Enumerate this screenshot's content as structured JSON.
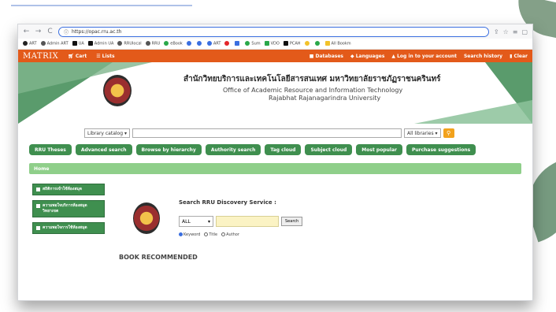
{
  "browser": {
    "nav_back": "←",
    "nav_forward": "→",
    "nav_reload": "C",
    "url": "https://opac.rru.ac.th",
    "bookmarks": [
      "ART",
      "Admin ART",
      "UA",
      "Admin UA",
      "RRUlocal",
      "RRU",
      "eBook",
      "ART",
      "Sum",
      "VDO ",
      "PCAH",
      "All Bookm"
    ]
  },
  "navbar": {
    "logo": "MATRIX",
    "cart": "Cart",
    "lists": "Lists",
    "databases": "Databases",
    "languages": "Languages",
    "login": "Log in to your account",
    "history": "Search history",
    "clear": "Clear"
  },
  "header": {
    "org_thai": "สำนักวิทยบริการและเทคโนโลยีสารสนเทศ มหาวิทยาลัยราชภัฏราชนครินทร์",
    "org_en_1": "Office of Academic Resource and Information Technology",
    "org_en_2": "Rajabhat Rajanagarindra University"
  },
  "search": {
    "catalog_select": "Library catalog",
    "libraries_select": "All libraries"
  },
  "tabs": [
    "RRU Theses",
    "Advanced search",
    "Browse by hierarchy",
    "Authority search",
    "Tag cloud",
    "Subject cloud",
    "Most popular",
    "Purchase suggestions"
  ],
  "breadcrumb": "Home",
  "sidebar": {
    "items": [
      "สถิติการเข้าใช้ห้องสมุด",
      "ความพอใจบริการห้องสมุดวิทยาเขต",
      "ความพอใจการใช้ห้องสมุด"
    ]
  },
  "discovery": {
    "title": "Search RRU Discovery Service :",
    "select_value": "ALL",
    "button": "Search",
    "radio_keyword": "Keyword",
    "radio_title": "Title",
    "radio_author": "Author"
  },
  "section_title": "BOOK RECOMMENDED"
}
